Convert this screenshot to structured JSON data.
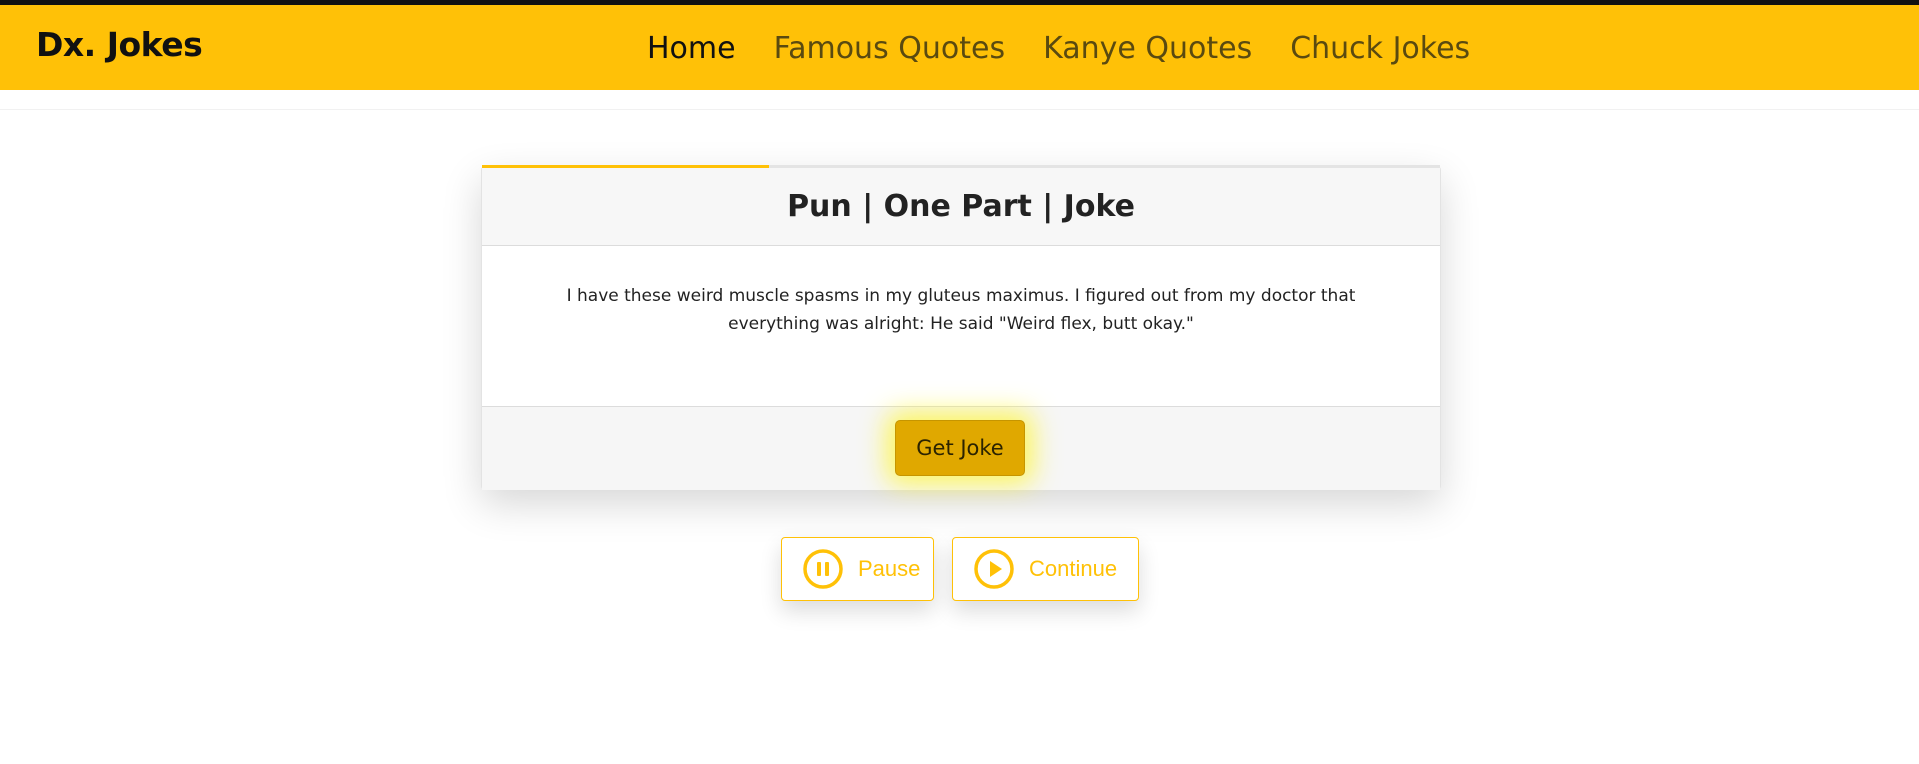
{
  "nav": {
    "brand": "Dx. Jokes",
    "links": [
      {
        "label": "Home",
        "active": true
      },
      {
        "label": "Famous Quotes",
        "active": false
      },
      {
        "label": "Kanye Quotes",
        "active": false
      },
      {
        "label": "Chuck Jokes",
        "active": false
      }
    ]
  },
  "card": {
    "title": "Pun | One Part | Joke",
    "joke": "I have these weird muscle spasms in my gluteus maximus. I figured out from my doctor that everything was alright: He said \"Weird flex, butt okay.\"",
    "progress": 0.3,
    "button_label": "Get Joke"
  },
  "controls": {
    "pause_label": "Pause",
    "pause_icon": "pause-circle-icon",
    "continue_label": "Continue",
    "continue_icon": "play-circle-icon"
  },
  "colors": {
    "accent": "#ffc107",
    "button": "#e0a800",
    "topline": "#111111"
  }
}
